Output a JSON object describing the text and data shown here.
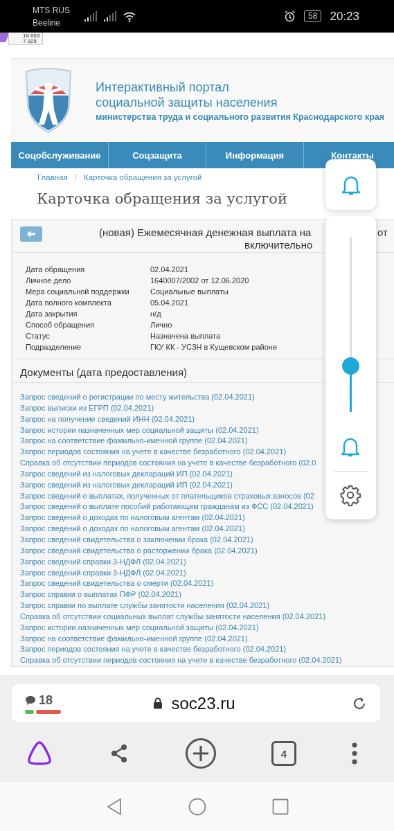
{
  "status_bar": {
    "carriers": [
      "MTS RUS",
      "Beeline"
    ],
    "battery": "58",
    "time": "20:23"
  },
  "counter_widget": {
    "lines": [
      "16 663",
      "7 925"
    ]
  },
  "site": {
    "title_lines": [
      "Интерактивный портал",
      "социальной защиты населения"
    ],
    "subtitle": "министерства труда и социального развития Краснодарского края",
    "nav": [
      "Соцобслуживание",
      "Соцзащита",
      "Информация",
      "Контакты"
    ],
    "breadcrumb": [
      "Главная",
      "Карточка обращения за услугой"
    ],
    "breadcrumb_separator": "/",
    "page_title": "Карточка обращения за услугой"
  },
  "card": {
    "title_parts": [
      "(новая) Ежемесячная денежная выплата на",
      "от"
    ],
    "title_line2": "включительно",
    "details": [
      {
        "label": "Дата обращения",
        "value": "02.04.2021"
      },
      {
        "label": "Личное дело",
        "value": "1640007/2002 от 12.06.2020"
      },
      {
        "label": "Мера социальной поддержки",
        "value": "Социальные выплаты"
      },
      {
        "label": "Дата полного комплекта",
        "value": "05.04.2021"
      },
      {
        "label": "Дата закрытия",
        "value": "н/д"
      },
      {
        "label": "Способ обращения",
        "value": "Лично"
      },
      {
        "label": "Статус",
        "value": "Назначена выплата"
      },
      {
        "label": "Подразделение",
        "value": "ГКУ КК - УСЗН в Кущевском районе"
      }
    ],
    "documents_heading": "Документы (дата предоставления)",
    "documents": [
      "Запрос сведений о регистрации по месту жительства (02.04.2021)",
      "Запрос выписки из ЕГРП (02.04.2021)",
      "Запрос на получение сведений ИНН (02.04.2021)",
      "Запрос истории назначенных мер социальной защиты (02.04.2021)",
      "Запрос на соответствие фамильно-именной группе (02.04.2021)",
      "Запрос периодов состояния на учете в качестве безработного (02.04.2021)",
      "Справка об отсутствии периодов состояния на учете в качестве безработного (02.0",
      "Запрос сведений из налоговых деклараций ИП (02.04.2021)",
      "Запрос сведений из налоговых деклараций ИП (02.04.2021)",
      "Запрос сведений о выплатах, полученных от плательщиков страховых взносов (02",
      "Запрос сведений о выплате пособий работающим гражданам из ФСС (02.04.2021)",
      "Запрос сведений о доходах по налоговым агентам (02.04.2021)",
      "Запрос сведений о доходах по налоговым агентам (02.04.2021)",
      "Запрос сведений свидетельства о заключении брака (02.04.2021)",
      "Запрос сведений свидетельства о расторжении брака (02.04.2021)",
      "Запрос сведений справки 3-НДФЛ (02.04.2021)",
      "Запрос сведений справки 3-НДФЛ (02.04.2021)",
      "Запрос сведений свидетельства о смерти (02.04.2021)",
      "Запрос справки о выплатах ПФР (02.04.2021)",
      "Запрос справки по выплате службы занятости населения (02.04.2021)",
      "Справка об отсутствии социальных выплат службы занятости населения (02.04.2021)",
      "Запрос истории назначенных мер социальной защиты (02.04.2021)",
      "Запрос на соответствие фамильно-именной группе (02.04.2021)",
      "Запрос периодов состояния на учете в качестве безработного (02.04.2021)",
      "Справка об отсутствии периодов состояния на учете в качестве безработного (02.04.2021)"
    ]
  },
  "volume_panel": {
    "level": 0.26
  },
  "browser": {
    "comments": "18",
    "url": "soc23.ru",
    "tabs_count": "4"
  }
}
